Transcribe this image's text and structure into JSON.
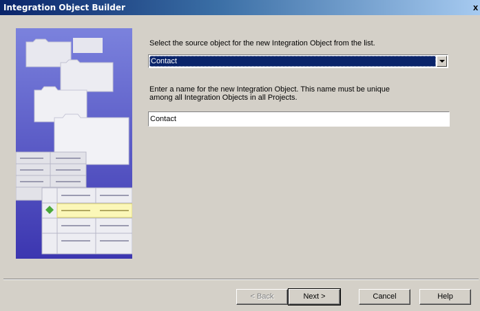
{
  "window": {
    "title": "Integration Object Builder",
    "close_glyph": "x"
  },
  "step": {
    "source_prompt": "Select the source object for the new Integration Object from the list.",
    "source_selected": "Contact",
    "name_prompt": "Enter a name for the new Integration Object. This name must be unique among all Integration Objects in all Projects.",
    "name_value": "Contact"
  },
  "buttons": {
    "back": "< Back",
    "next": "Next >",
    "cancel": "Cancel",
    "help": "Help"
  },
  "colors": {
    "titlebar_start": "#0a246a",
    "selection": "#0a246a",
    "dialog_bg": "#d4d0c8",
    "art_bg": "#6b6bd6"
  }
}
